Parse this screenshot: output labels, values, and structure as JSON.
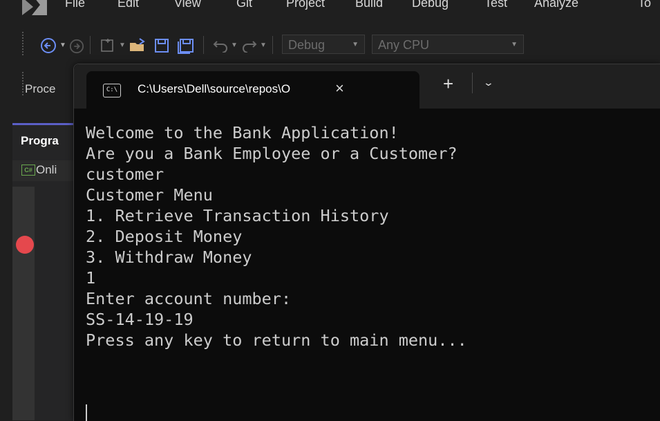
{
  "vs": {
    "menu": [
      "File",
      "Edit",
      "View",
      "Git",
      "Project",
      "Build",
      "Debug",
      "Test",
      "Analyze",
      "To"
    ],
    "toolbar": {
      "config_dropdown": "Debug",
      "platform_dropdown": "Any CPU"
    },
    "process_label": "Proce",
    "panel_title": "Progra",
    "panel_item": "Onli",
    "breakpoint_color": "#e5484d"
  },
  "terminal": {
    "tab_title": "C:\\Users\\Dell\\source\\repos\\O",
    "tab_icon_text": "C:\\",
    "close_glyph": "×",
    "new_tab_glyph": "+",
    "dropdown_glyph": "⌄",
    "lines": [
      "Welcome to the Bank Application!",
      "Are you a Bank Employee or a Customer?",
      "customer",
      "Customer Menu",
      "1. Retrieve Transaction History",
      "2. Deposit Money",
      "3. Withdraw Money",
      "1",
      "Enter account number:",
      "SS-14-19-19",
      "Press any key to return to main menu..."
    ]
  },
  "colors": {
    "terminal_bg": "#0c0c0c",
    "vs_bg": "#1f1f1f",
    "accent": "#5b5fc7"
  }
}
